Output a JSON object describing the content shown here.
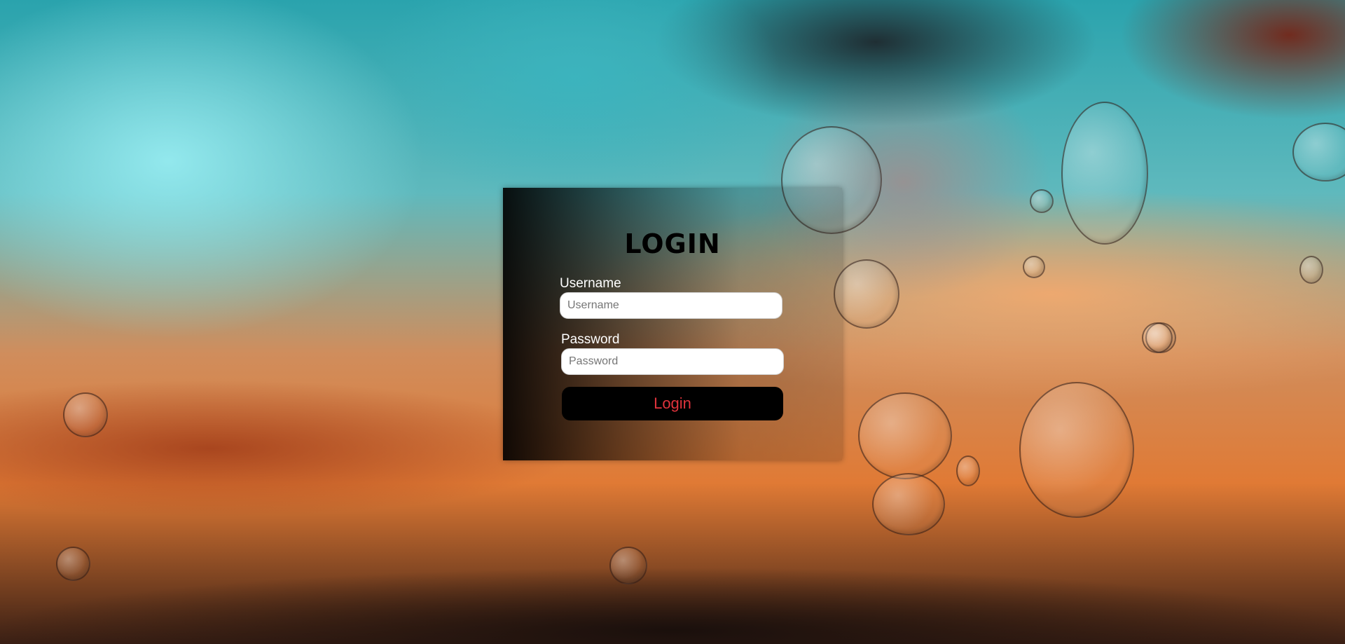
{
  "login_form": {
    "title": "LOGIN",
    "username_label": "Username",
    "username_placeholder": "Username",
    "username_value": "",
    "password_label": "Password",
    "password_placeholder": "Password",
    "password_value": "",
    "submit_label": "Login"
  },
  "colors": {
    "button_background": "#000000",
    "button_text": "#e0333c",
    "label_text": "#ffffff",
    "title_text": "#000000"
  }
}
